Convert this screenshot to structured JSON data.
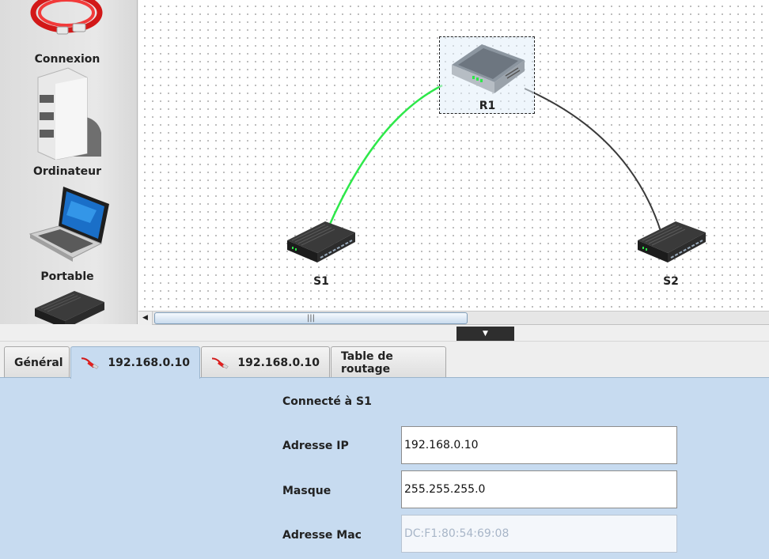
{
  "palette": {
    "items": [
      {
        "label": "Connexion",
        "icon": "network-cable-icon"
      },
      {
        "label": "Ordinateur",
        "icon": "desktop-tower-icon"
      },
      {
        "label": "Portable",
        "icon": "laptop-icon"
      },
      {
        "label": "",
        "icon": "switch-icon"
      }
    ]
  },
  "canvas": {
    "nodes": [
      {
        "id": "R1",
        "label": "R1",
        "type": "router"
      },
      {
        "id": "S1",
        "label": "S1",
        "type": "switch"
      },
      {
        "id": "S2",
        "label": "S2",
        "type": "switch"
      }
    ],
    "links": [
      {
        "from": "R1",
        "to": "S1",
        "color": "#2ee84a"
      },
      {
        "from": "R1",
        "to": "S2",
        "color": "#3a3a3a"
      }
    ],
    "selected": "R1"
  },
  "scrollbar": {
    "thumb_grip": "|||",
    "left_arrow": "◀"
  },
  "splitter": {
    "arrow": "▼"
  },
  "tabs": [
    {
      "label": "Général",
      "icon": ""
    },
    {
      "label": "192.168.0.10",
      "icon": "network-cable-icon",
      "active": true
    },
    {
      "label": "192.168.0.10",
      "icon": "network-cable-icon"
    },
    {
      "label": "Table de routage",
      "icon": ""
    }
  ],
  "panel": {
    "connected_to": "Connecté à S1",
    "ip_label": "Adresse IP",
    "ip_value": "192.168.0.10",
    "mask_label": "Masque",
    "mask_value": "255.255.255.0",
    "mac_label": "Adresse Mac",
    "mac_value": "DC:F1:80:54:69:08"
  },
  "colors": {
    "panel_bg": "#c7dbf0",
    "active_link": "#2ee84a",
    "link": "#3a3a3a"
  }
}
